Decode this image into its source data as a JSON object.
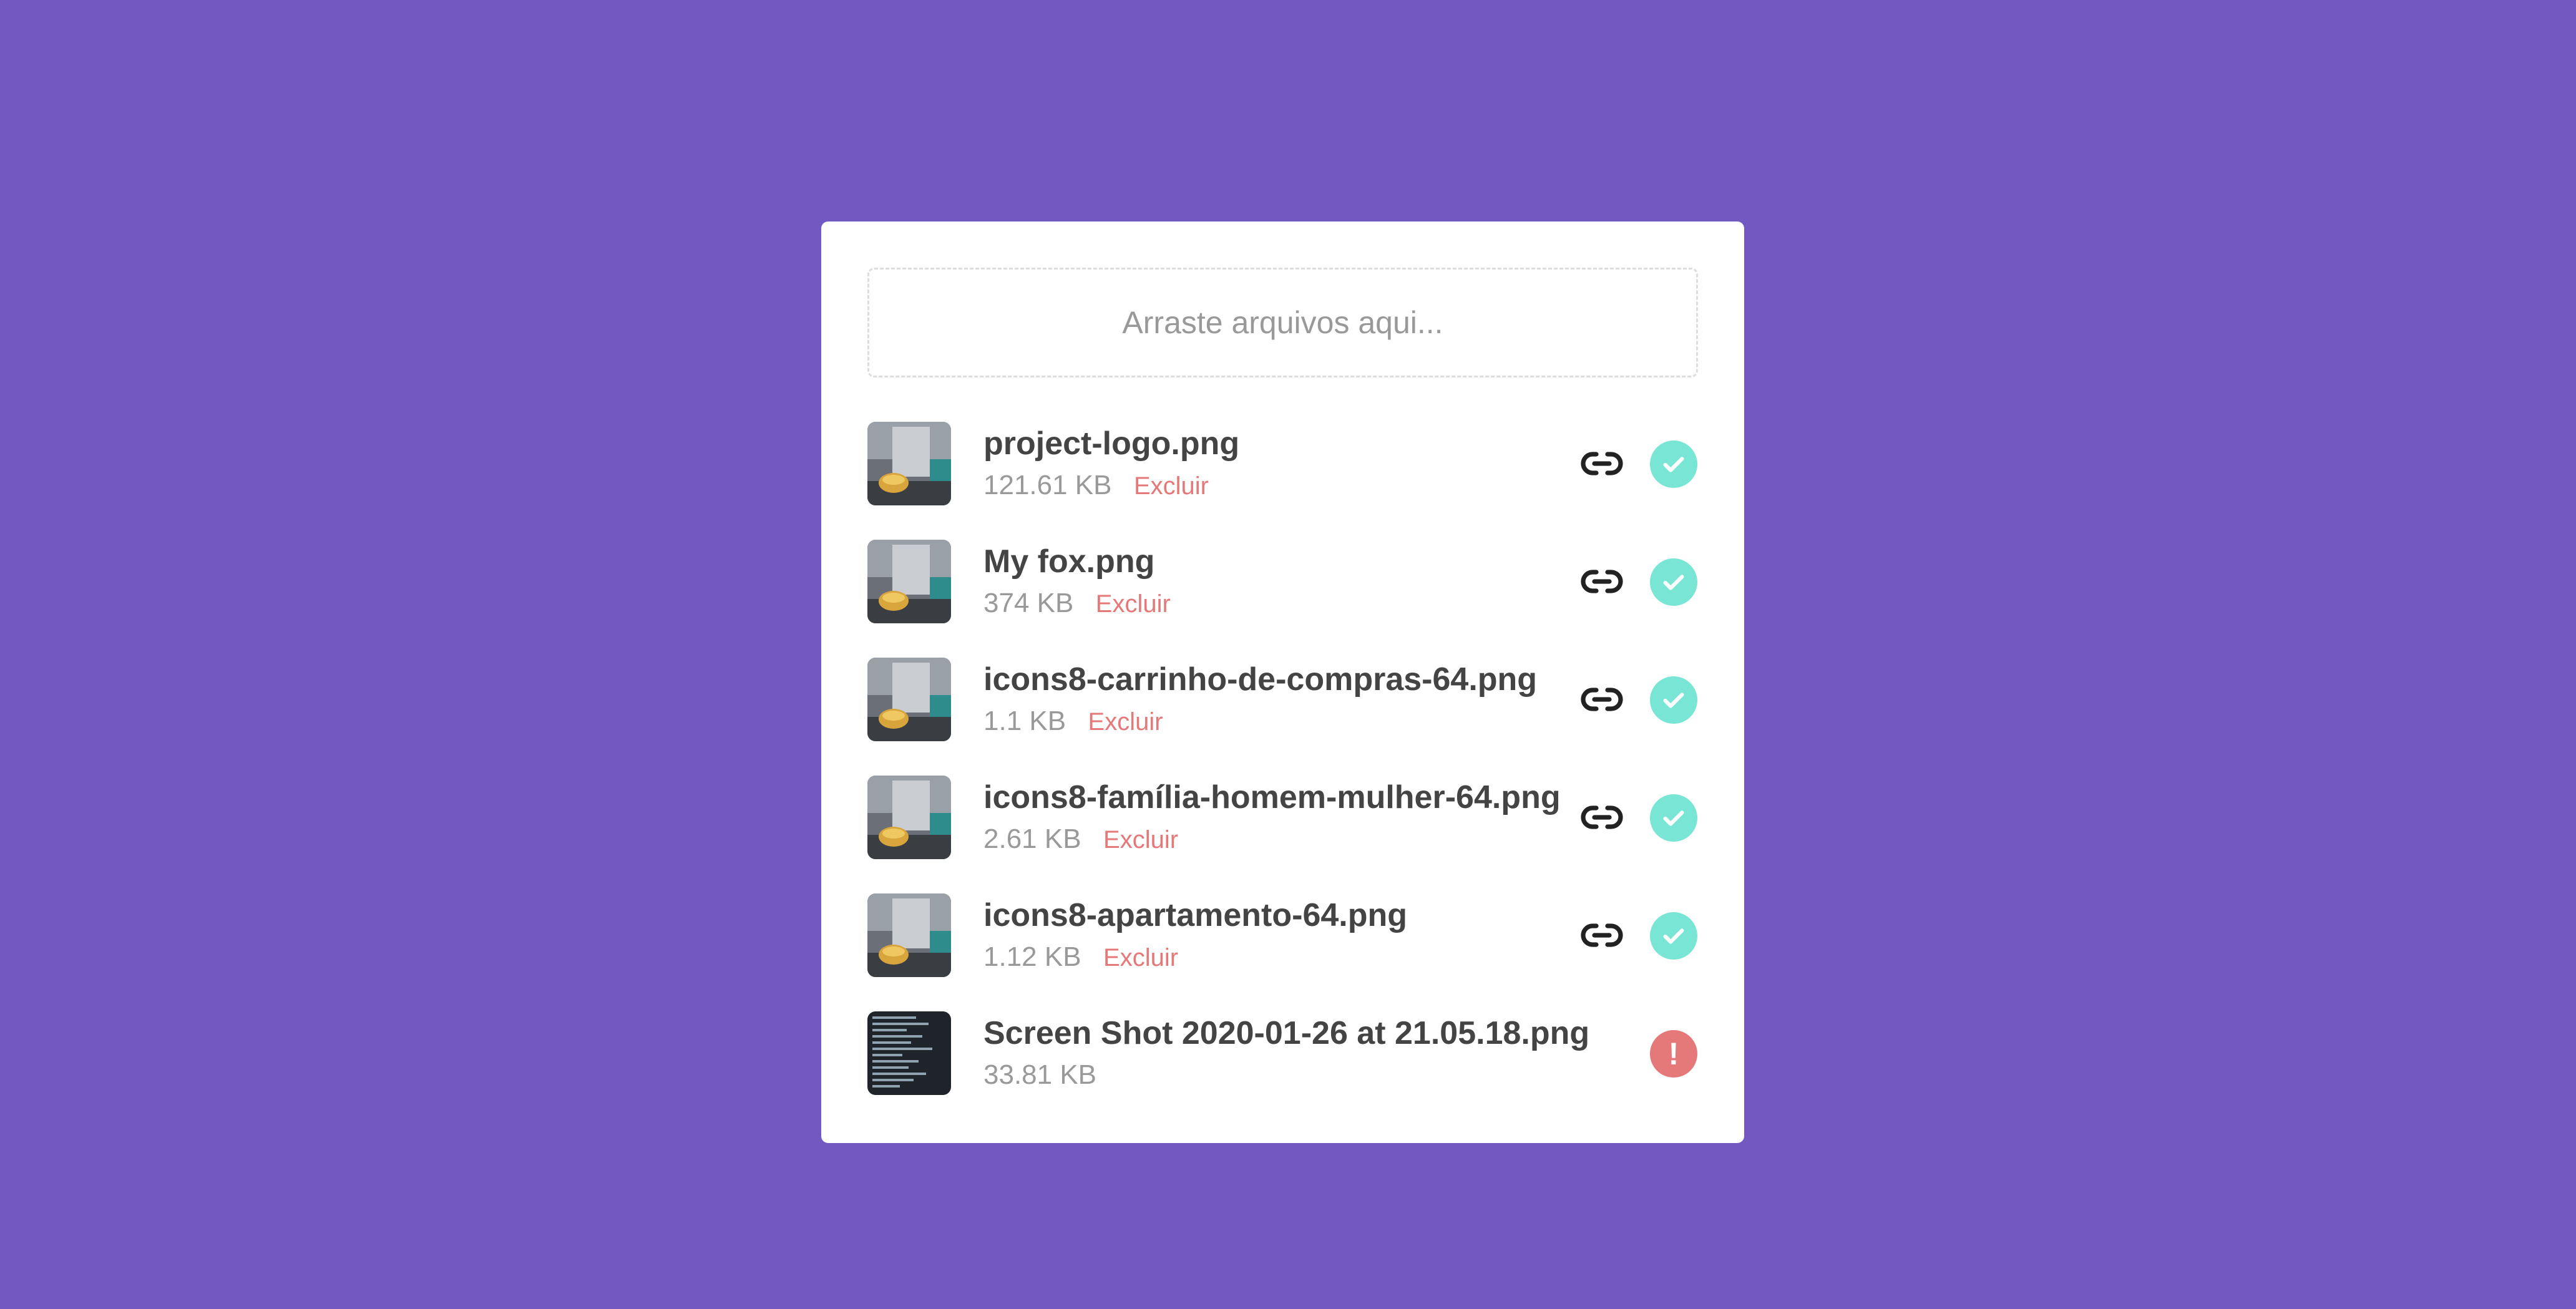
{
  "dropzone": {
    "text": "Arraste arquivos aqui..."
  },
  "colors": {
    "background": "#7159c1",
    "success": "#78e5d5",
    "error": "#e57878"
  },
  "files": [
    {
      "name": "project-logo.png",
      "size": "121.61 KB",
      "delete_label": "Excluir",
      "status": "uploaded",
      "status_icon": "check-circle-icon",
      "thumbnail": "photo-thumbnail"
    },
    {
      "name": "My fox.png",
      "size": "374 KB",
      "delete_label": "Excluir",
      "status": "uploaded",
      "status_icon": "check-circle-icon",
      "thumbnail": "photo-thumbnail"
    },
    {
      "name": "icons8-carrinho-de-compras-64.png",
      "size": "1.1 KB",
      "delete_label": "Excluir",
      "status": "uploaded",
      "status_icon": "check-circle-icon",
      "thumbnail": "photo-thumbnail"
    },
    {
      "name": "icons8-família-homem-mulher-64.png",
      "size": "2.61 KB",
      "delete_label": "Excluir",
      "status": "uploaded",
      "status_icon": "check-circle-icon",
      "thumbnail": "photo-thumbnail"
    },
    {
      "name": "icons8-apartamento-64.png",
      "size": "1.12 KB",
      "delete_label": "Excluir",
      "status": "uploaded",
      "status_icon": "check-circle-icon",
      "thumbnail": "photo-thumbnail"
    },
    {
      "name": "Screen Shot 2020-01-26 at 21.05.18.png",
      "size": "33.81 KB",
      "status": "error",
      "status_icon": "error-circle-icon",
      "thumbnail": "screenshot-thumbnail"
    }
  ]
}
